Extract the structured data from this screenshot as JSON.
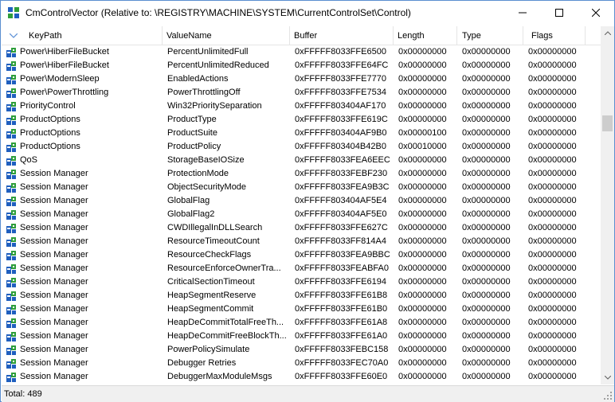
{
  "window": {
    "title": "CmControlVector (Relative to: \\REGISTRY\\MACHINE\\SYSTEM\\CurrentControlSet\\Control)"
  },
  "columns": [
    "KeyPath",
    "ValueName",
    "Buffer",
    "Length",
    "Type",
    "Flags"
  ],
  "rows": [
    [
      "Power\\HiberFileBucket",
      "PercentUnlimitedFull",
      "0xFFFFF8033FFE6500",
      "0x00000000",
      "0x00000000",
      "0x00000000"
    ],
    [
      "Power\\HiberFileBucket",
      "PercentUnlimitedReduced",
      "0xFFFFF8033FFE64FC",
      "0x00000000",
      "0x00000000",
      "0x00000000"
    ],
    [
      "Power\\ModernSleep",
      "EnabledActions",
      "0xFFFFF8033FFE7770",
      "0x00000000",
      "0x00000000",
      "0x00000000"
    ],
    [
      "Power\\PowerThrottling",
      "PowerThrottlingOff",
      "0xFFFFF8033FFE7534",
      "0x00000000",
      "0x00000000",
      "0x00000000"
    ],
    [
      "PriorityControl",
      "Win32PrioritySeparation",
      "0xFFFFF803404AF170",
      "0x00000000",
      "0x00000000",
      "0x00000000"
    ],
    [
      "ProductOptions",
      "ProductType",
      "0xFFFFF8033FFE619C",
      "0x00000000",
      "0x00000000",
      "0x00000000"
    ],
    [
      "ProductOptions",
      "ProductSuite",
      "0xFFFFF803404AF9B0",
      "0x00000100",
      "0x00000000",
      "0x00000000"
    ],
    [
      "ProductOptions",
      "ProductPolicy",
      "0xFFFFF803404B42B0",
      "0x00010000",
      "0x00000000",
      "0x00000000"
    ],
    [
      "QoS",
      "StorageBaseIOSize",
      "0xFFFFF8033FEA6EEC",
      "0x00000000",
      "0x00000000",
      "0x00000000"
    ],
    [
      "Session Manager",
      "ProtectionMode",
      "0xFFFFF8033FEBF230",
      "0x00000000",
      "0x00000000",
      "0x00000000"
    ],
    [
      "Session Manager",
      "ObjectSecurityMode",
      "0xFFFFF8033FEA9B3C",
      "0x00000000",
      "0x00000000",
      "0x00000000"
    ],
    [
      "Session Manager",
      "GlobalFlag",
      "0xFFFFF803404AF5E4",
      "0x00000000",
      "0x00000000",
      "0x00000000"
    ],
    [
      "Session Manager",
      "GlobalFlag2",
      "0xFFFFF803404AF5E0",
      "0x00000000",
      "0x00000000",
      "0x00000000"
    ],
    [
      "Session Manager",
      "CWDIllegalInDLLSearch",
      "0xFFFFF8033FFE627C",
      "0x00000000",
      "0x00000000",
      "0x00000000"
    ],
    [
      "Session Manager",
      "ResourceTimeoutCount",
      "0xFFFFF8033FF814A4",
      "0x00000000",
      "0x00000000",
      "0x00000000"
    ],
    [
      "Session Manager",
      "ResourceCheckFlags",
      "0xFFFFF8033FEA9BBC",
      "0x00000000",
      "0x00000000",
      "0x00000000"
    ],
    [
      "Session Manager",
      "ResourceEnforceOwnerTra...",
      "0xFFFFF8033FEABFA0",
      "0x00000000",
      "0x00000000",
      "0x00000000"
    ],
    [
      "Session Manager",
      "CriticalSectionTimeout",
      "0xFFFFF8033FFE6194",
      "0x00000000",
      "0x00000000",
      "0x00000000"
    ],
    [
      "Session Manager",
      "HeapSegmentReserve",
      "0xFFFFF8033FFE61B8",
      "0x00000000",
      "0x00000000",
      "0x00000000"
    ],
    [
      "Session Manager",
      "HeapSegmentCommit",
      "0xFFFFF8033FFE61B0",
      "0x00000000",
      "0x00000000",
      "0x00000000"
    ],
    [
      "Session Manager",
      "HeapDeCommitTotalFreeTh...",
      "0xFFFFF8033FFE61A8",
      "0x00000000",
      "0x00000000",
      "0x00000000"
    ],
    [
      "Session Manager",
      "HeapDeCommitFreeBlockTh...",
      "0xFFFFF8033FFE61A0",
      "0x00000000",
      "0x00000000",
      "0x00000000"
    ],
    [
      "Session Manager",
      "PowerPolicySimulate",
      "0xFFFFF8033FEBC158",
      "0x00000000",
      "0x00000000",
      "0x00000000"
    ],
    [
      "Session Manager",
      "Debugger Retries",
      "0xFFFFF8033FEC70A0",
      "0x00000000",
      "0x00000000",
      "0x00000000"
    ],
    [
      "Session Manager",
      "DebuggerMaxModuleMsgs",
      "0xFFFFF8033FFE60E0",
      "0x00000000",
      "0x00000000",
      "0x00000000"
    ]
  ],
  "status": {
    "total": "Total: 489"
  },
  "icons": {
    "app": "registry-icon",
    "row": "registry-key-icon",
    "minimize": "minimize-icon",
    "maximize": "maximize-icon",
    "close": "close-icon",
    "sort": "sort-descending-icon"
  },
  "colors": {
    "key_icon_blue": "#1f5fbf",
    "key_icon_green": "#2e9e3a",
    "window_border": "#5a8ed0"
  }
}
